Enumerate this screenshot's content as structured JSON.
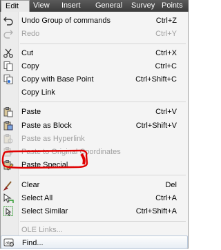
{
  "menubar": {
    "items": [
      "Edit",
      "View",
      "Insert",
      "General",
      "Survey",
      "Points"
    ]
  },
  "menu": {
    "items": [
      {
        "label": "Undo Group of commands",
        "shortcut": "Ctrl+Z",
        "icon": "undo-icon"
      },
      {
        "label": "Redo",
        "shortcut": "Ctrl+Y",
        "icon": "redo-icon",
        "disabled": true
      },
      {
        "label": "Cut",
        "shortcut": "Ctrl+X",
        "icon": "scissors-icon"
      },
      {
        "label": "Copy",
        "shortcut": "Ctrl+C",
        "icon": "copy-icon"
      },
      {
        "label": "Copy with Base Point",
        "shortcut": "Ctrl+Shift+C",
        "icon": "copy-base-point-icon"
      },
      {
        "label": "Copy Link",
        "shortcut": "",
        "icon": ""
      },
      {
        "label": "Paste",
        "shortcut": "Ctrl+V",
        "icon": "paste-icon"
      },
      {
        "label": "Paste as Block",
        "shortcut": "Ctrl+Shift+V",
        "icon": "paste-block-icon"
      },
      {
        "label": "Paste as Hyperlink",
        "shortcut": "",
        "icon": "paste-hyperlink-icon",
        "disabled": true
      },
      {
        "label": "Paste to Original Coordinates",
        "shortcut": "",
        "icon": "paste-coordinates-icon",
        "disabled": true
      },
      {
        "label": "Paste Special...",
        "shortcut": "",
        "icon": "paste-special-icon"
      },
      {
        "label": "Clear",
        "shortcut": "Del",
        "icon": "eraser-icon"
      },
      {
        "label": "Select All",
        "shortcut": "Ctrl+A",
        "icon": "select-all-icon"
      },
      {
        "label": "Select Similar",
        "shortcut": "Ctrl+Shift+A",
        "icon": "select-similar-icon"
      },
      {
        "label": "OLE Links...",
        "shortcut": "",
        "icon": "",
        "disabled": true
      },
      {
        "label": "Find...",
        "shortcut": "",
        "icon": "find-icon"
      }
    ]
  },
  "colors": {
    "annotation": "#e00000",
    "menubar": "#4a4a4a"
  }
}
